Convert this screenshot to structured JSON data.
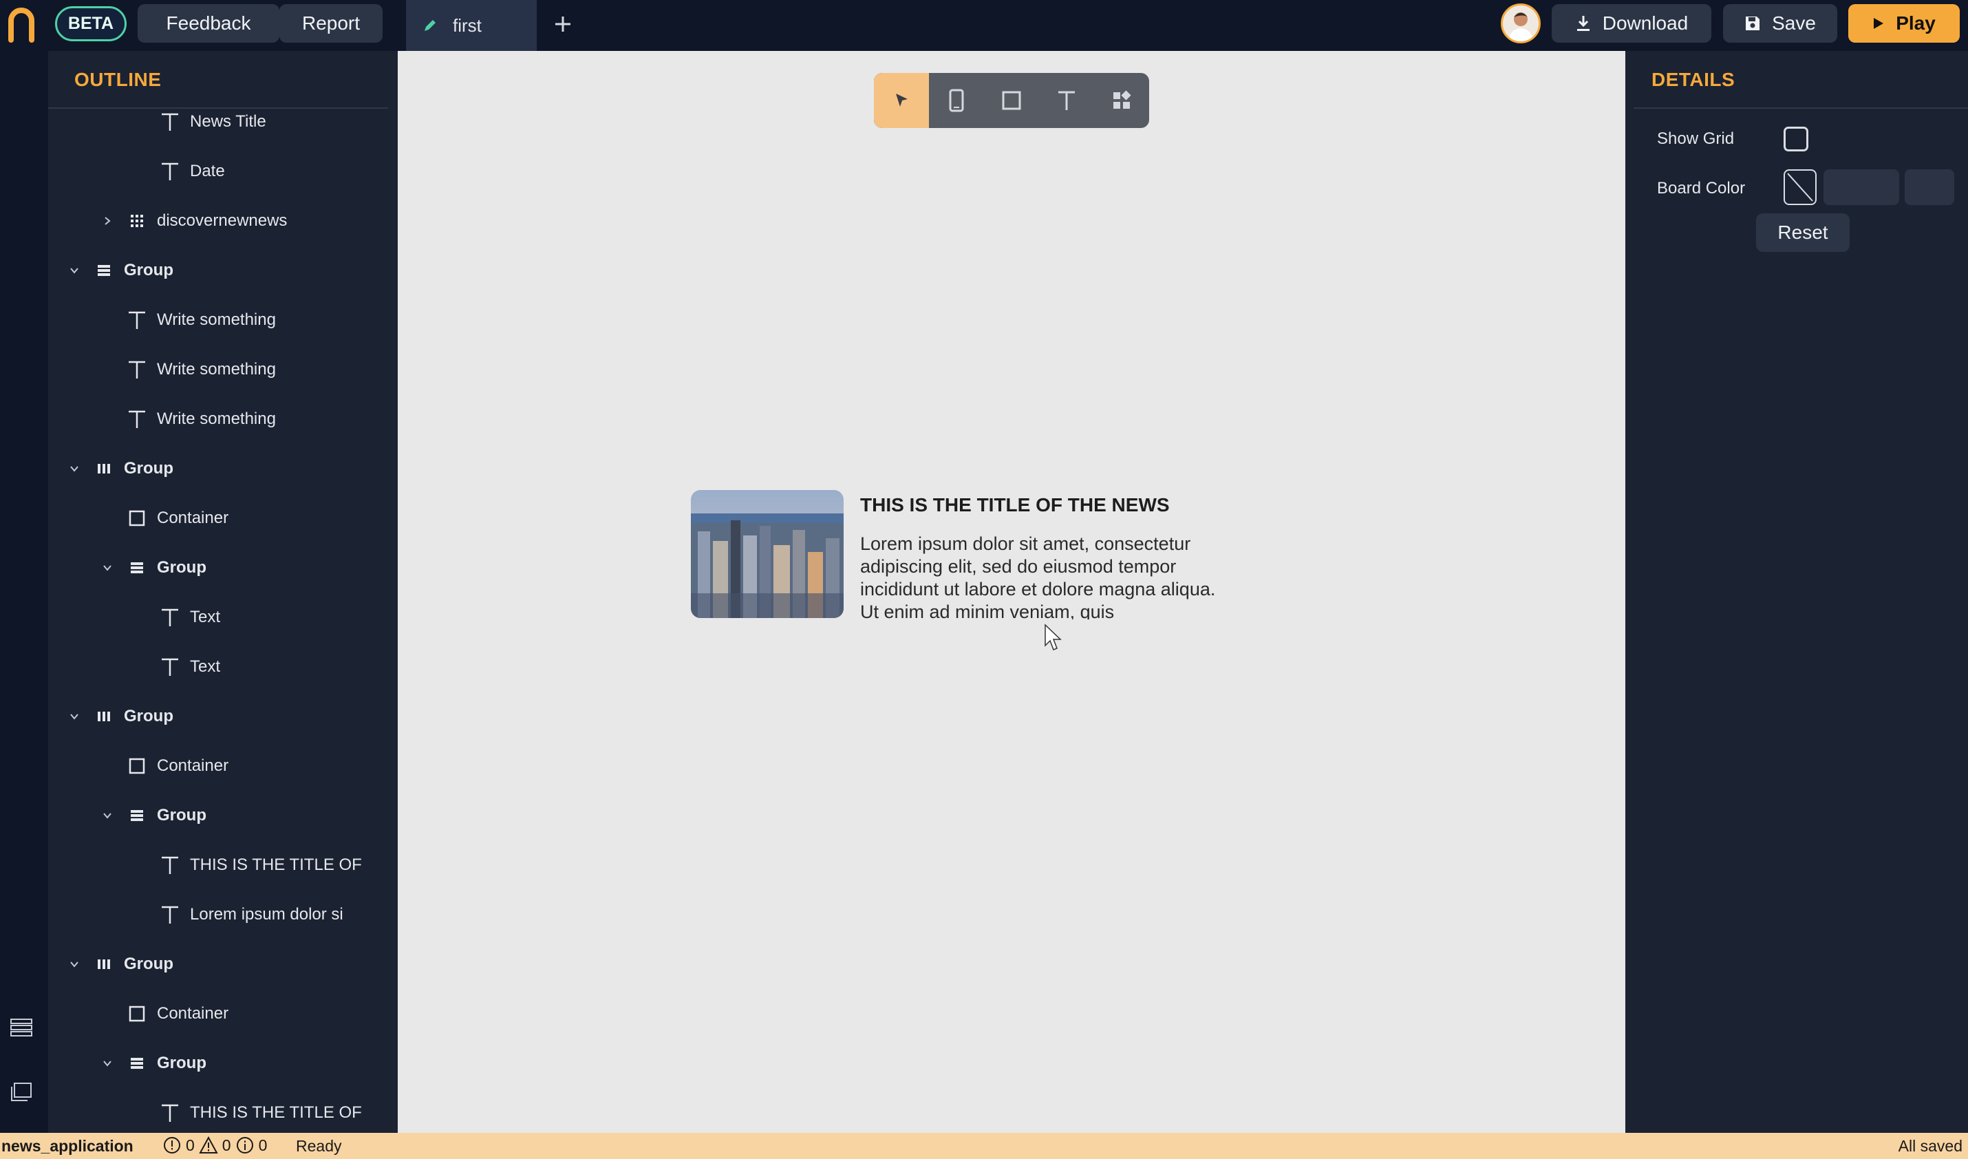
{
  "topbar": {
    "beta": "BETA",
    "feedback": "Feedback",
    "report": "Report",
    "tab_label": "first",
    "download": "Download",
    "save": "Save",
    "play": "Play"
  },
  "outline": {
    "title": "OUTLINE",
    "items": [
      {
        "label": "News Title",
        "type": "text"
      },
      {
        "label": "Date",
        "type": "text"
      },
      {
        "label": "discovernewnews",
        "type": "grid",
        "collapsed": true
      },
      {
        "label": "Group",
        "type": "column-group"
      },
      {
        "label": "Write something",
        "type": "text"
      },
      {
        "label": "Write something",
        "type": "text"
      },
      {
        "label": "Write something",
        "type": "text"
      },
      {
        "label": "Group",
        "type": "row-group"
      },
      {
        "label": "Container",
        "type": "container"
      },
      {
        "label": "Group",
        "type": "column-group"
      },
      {
        "label": "Text",
        "type": "text"
      },
      {
        "label": "Text",
        "type": "text"
      },
      {
        "label": "Group",
        "type": "row-group"
      },
      {
        "label": "Container",
        "type": "container"
      },
      {
        "label": "Group",
        "type": "column-group"
      },
      {
        "label": "THIS IS THE TITLE OF",
        "type": "text"
      },
      {
        "label": "Lorem ipsum dolor si",
        "type": "text"
      },
      {
        "label": "Group",
        "type": "row-group"
      },
      {
        "label": "Container",
        "type": "container"
      },
      {
        "label": "Group",
        "type": "column-group"
      },
      {
        "label": "THIS IS THE TITLE OF",
        "type": "text"
      }
    ]
  },
  "canvas": {
    "news_title": "THIS IS THE TITLE OF THE NEWS",
    "news_body": "Lorem ipsum dolor sit amet, consectetur adipiscing elit, sed do eiusmod tempor incididunt ut labore et dolore magna aliqua. Ut enim ad minim veniam, quis"
  },
  "details": {
    "title": "DETAILS",
    "show_grid_label": "Show Grid",
    "show_grid_checked": false,
    "board_color_label": "Board Color",
    "reset": "Reset"
  },
  "status": {
    "project": "news_application",
    "errors": "0",
    "warnings": "0",
    "infos": "0",
    "state": "Ready",
    "saved": "All saved"
  },
  "colors": {
    "accent": "#f6a93b",
    "beta_border": "#4fd1a5",
    "panel_bg": "#1b2232",
    "topbar_bg": "#0f1628",
    "canvas_bg": "#e8e8e8",
    "status_bg": "#f8d4a2"
  }
}
